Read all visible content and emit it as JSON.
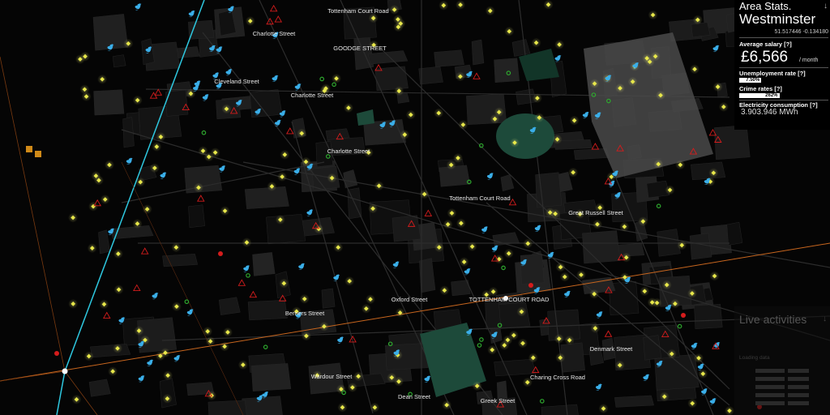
{
  "panel": {
    "title": "Area Stats.",
    "collapse_icon": "arrow-down-icon",
    "area_name": "Westminster",
    "coordinates": "51.517446 -0.134180",
    "salary_label": "Average salary [?]",
    "salary_value": "£6,566",
    "salary_unit": "/ month",
    "unemployment_label": "Unemployment rate [?]",
    "unemployment_value": "7.50%",
    "unemployment_fraction": 0.075,
    "crime_label": "Crime rates [?]",
    "crime_value": "262%",
    "crime_fraction": 1.0,
    "electricity_label": "Electricity consumption [?]",
    "electricity_value": "3.903.946 MWh"
  },
  "live": {
    "title": "Live activities",
    "collapse_icon": "arrow-down-icon",
    "loading_text": "Loading data"
  },
  "streets": [
    {
      "name": "Tottenham Court Road"
    },
    {
      "name": "Charlotte Street"
    },
    {
      "name": "GOODGE STREET"
    },
    {
      "name": "Cleveland Street"
    },
    {
      "name": "Charlotte Street"
    },
    {
      "name": "Charlotte Street"
    },
    {
      "name": "Tottenham Court Road"
    },
    {
      "name": "Great Russell Street"
    },
    {
      "name": "Oxford Street"
    },
    {
      "name": "TOTTENHAM COURT ROAD"
    },
    {
      "name": "Berners Street"
    },
    {
      "name": "Denmark Street"
    },
    {
      "name": "Wardour Street"
    },
    {
      "name": "Charing Cross Road"
    },
    {
      "name": "Dean Street"
    },
    {
      "name": "Greek Street"
    }
  ],
  "colors": {
    "background": "#050505",
    "sensor": "#e8e84a",
    "tweet": "#3aaee8",
    "alert": "#d41c1c",
    "green_dot": "#2ea82e",
    "park": "#1d4a3a",
    "orange_line": "#c8661e",
    "cyan_line": "#2ec8e0"
  }
}
